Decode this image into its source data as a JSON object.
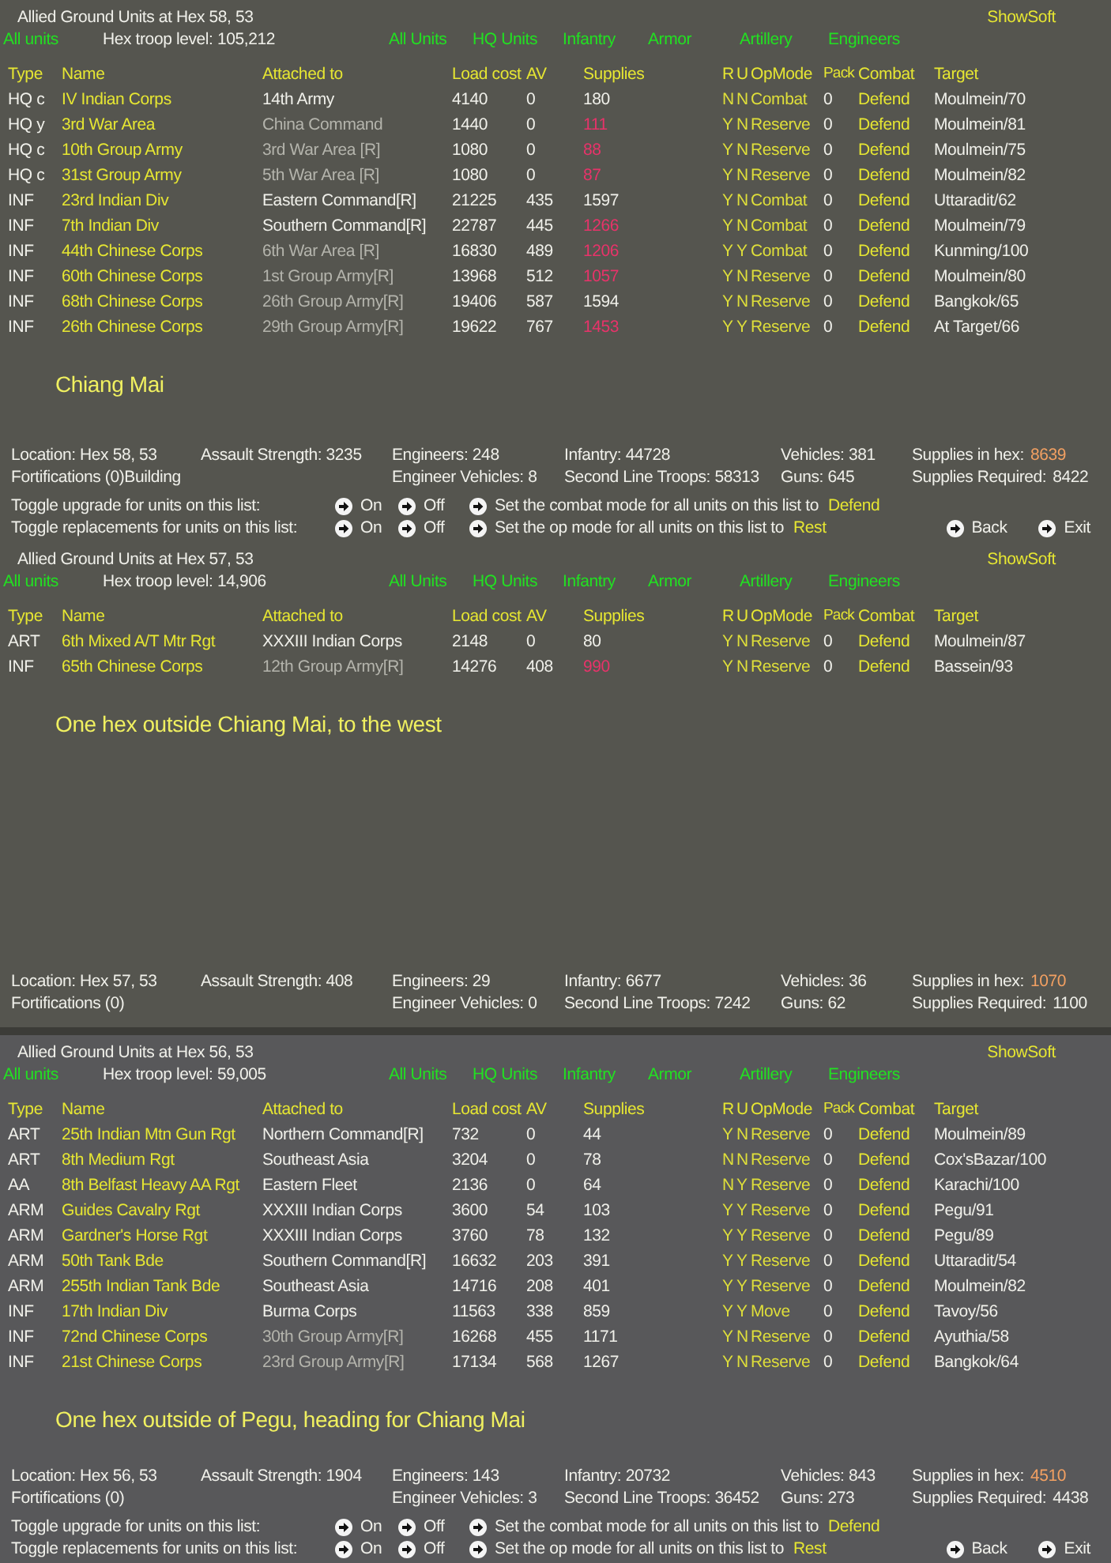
{
  "panels": [
    {
      "title": "Allied Ground Units at Hex 58, 53",
      "filter_label": "All units",
      "troop_level": "Hex troop level: 105,212",
      "filters": [
        "All Units",
        "HQ Units",
        "Infantry",
        "Armor",
        "Artillery",
        "Engineers"
      ],
      "show_soft": "ShowSoft",
      "columns": [
        "Type",
        "Name",
        "Attached to",
        "Load cost",
        "AV",
        "Supplies",
        "R",
        "U",
        "OpMode",
        "Pack",
        "Combat",
        "Target"
      ],
      "rows": [
        {
          "type": "HQ  c",
          "name": "IV Indian Corps",
          "attached": "14th Army",
          "attached_dimmed": false,
          "load": "4140",
          "av": "0",
          "supplies": "180",
          "supplies_low": false,
          "r": "N",
          "u": "N",
          "opmode": "Combat",
          "pack": "0",
          "combat": "Defend",
          "target": "Moulmein/70"
        },
        {
          "type": "HQ  y",
          "name": "3rd War Area",
          "attached": "China Command",
          "attached_dimmed": true,
          "load": "1440",
          "av": "0",
          "supplies": "111",
          "supplies_low": true,
          "r": "Y",
          "u": "N",
          "opmode": "Reserve",
          "pack": "0",
          "combat": "Defend",
          "target": "Moulmein/81"
        },
        {
          "type": "HQ  c",
          "name": "10th Group Army",
          "attached": "3rd War Area [R]",
          "attached_dimmed": true,
          "load": "1080",
          "av": "0",
          "supplies": "88",
          "supplies_low": true,
          "r": "Y",
          "u": "N",
          "opmode": "Reserve",
          "pack": "0",
          "combat": "Defend",
          "target": "Moulmein/75"
        },
        {
          "type": "HQ  c",
          "name": "31st Group Army",
          "attached": "5th War Area [R]",
          "attached_dimmed": true,
          "load": "1080",
          "av": "0",
          "supplies": "87",
          "supplies_low": true,
          "r": "Y",
          "u": "N",
          "opmode": "Reserve",
          "pack": "0",
          "combat": "Defend",
          "target": "Moulmein/82"
        },
        {
          "type": "INF",
          "name": "23rd Indian Div",
          "attached": "Eastern Command[R]",
          "attached_dimmed": false,
          "load": "21225",
          "av": "435",
          "supplies": "1597",
          "supplies_low": false,
          "r": "Y",
          "u": "N",
          "opmode": "Combat",
          "pack": "0",
          "combat": "Defend",
          "target": "Uttaradit/62"
        },
        {
          "type": "INF",
          "name": "7th Indian Div",
          "attached": "Southern Command[R]",
          "attached_dimmed": false,
          "load": "22787",
          "av": "445",
          "supplies": "1266",
          "supplies_low": true,
          "r": "Y",
          "u": "N",
          "opmode": "Combat",
          "pack": "0",
          "combat": "Defend",
          "target": "Moulmein/79"
        },
        {
          "type": "INF",
          "name": "44th Chinese Corps",
          "attached": "6th War Area [R]",
          "attached_dimmed": true,
          "load": "16830",
          "av": "489",
          "supplies": "1206",
          "supplies_low": true,
          "r": "Y",
          "u": "Y",
          "opmode": "Combat",
          "pack": "0",
          "combat": "Defend",
          "target": "Kunming/100"
        },
        {
          "type": "INF",
          "name": "60th Chinese Corps",
          "attached": "1st Group Army[R]",
          "attached_dimmed": true,
          "load": "13968",
          "av": "512",
          "supplies": "1057",
          "supplies_low": true,
          "r": "Y",
          "u": "N",
          "opmode": "Reserve",
          "pack": "0",
          "combat": "Defend",
          "target": "Moulmein/80"
        },
        {
          "type": "INF",
          "name": "68th Chinese Corps",
          "attached": "26th Group Army[R]",
          "attached_dimmed": true,
          "load": "19406",
          "av": "587",
          "supplies": "1594",
          "supplies_low": false,
          "r": "Y",
          "u": "N",
          "opmode": "Reserve",
          "pack": "0",
          "combat": "Defend",
          "target": "Bangkok/65"
        },
        {
          "type": "INF",
          "name": "26th Chinese Corps",
          "attached": "29th Group Army[R]",
          "attached_dimmed": true,
          "load": "19622",
          "av": "767",
          "supplies": "1453",
          "supplies_low": true,
          "r": "Y",
          "u": "Y",
          "opmode": "Reserve",
          "pack": "0",
          "combat": "Defend",
          "target": "At Target/66"
        }
      ],
      "note": "Chiang Mai",
      "stats": [
        [
          {
            "label": "Location: Hex 58, 53"
          },
          {
            "label": "Fortifications (0)Building"
          }
        ],
        [
          {
            "label": "Assault Strength: 3235"
          }
        ],
        [
          {
            "label": "Engineers:  248"
          },
          {
            "label": "Engineer Vehicles:  8"
          }
        ],
        [
          {
            "label": "Infantry: 44728"
          },
          {
            "label": "Second Line Troops: 58313"
          }
        ],
        [
          {
            "label": "Vehicles: 381"
          },
          {
            "label": "Guns: 645"
          }
        ],
        [
          {
            "label": "Supplies in hex:",
            "value": "8639",
            "highlight": true
          },
          {
            "label": "Supplies Required:",
            "value": "8422",
            "highlight": false
          }
        ]
      ],
      "toggles": [
        {
          "label": "Toggle upgrade for units on this list:",
          "on": "On",
          "off": "Off",
          "set_text": "Set the combat mode for all units on this list to",
          "set_value": "Defend"
        },
        {
          "label": "Toggle replacements for units on this list:",
          "on": "On",
          "off": "Off",
          "set_text": "Set the op mode for all units on this list to",
          "set_value": "Rest",
          "nav": [
            "Back",
            "Exit"
          ]
        }
      ]
    },
    {
      "title": "Allied Ground Units at Hex 57, 53",
      "filter_label": "All units",
      "troop_level": "Hex troop level: 14,906",
      "filters": [
        "All Units",
        "HQ Units",
        "Infantry",
        "Armor",
        "Artillery",
        "Engineers"
      ],
      "show_soft": "ShowSoft",
      "columns": [
        "Type",
        "Name",
        "Attached to",
        "Load cost",
        "AV",
        "Supplies",
        "R",
        "U",
        "OpMode",
        "Pack",
        "Combat",
        "Target"
      ],
      "rows": [
        {
          "type": "ART",
          "name": "6th Mixed A/T Mtr Rgt",
          "attached": "XXXIII Indian Corps",
          "attached_dimmed": false,
          "load": "2148",
          "av": "0",
          "supplies": "80",
          "supplies_low": false,
          "r": "Y",
          "u": "N",
          "opmode": "Reserve",
          "pack": "0",
          "combat": "Defend",
          "target": "Moulmein/87"
        },
        {
          "type": "INF",
          "name": "65th Chinese Corps",
          "attached": "12th Group Army[R]",
          "attached_dimmed": true,
          "load": "14276",
          "av": "408",
          "supplies": "990",
          "supplies_low": true,
          "r": "Y",
          "u": "N",
          "opmode": "Reserve",
          "pack": "0",
          "combat": "Defend",
          "target": "Bassein/93"
        }
      ],
      "note": "One hex outside Chiang Mai, to the west",
      "stats": [
        [
          {
            "label": "Location: Hex 57, 53"
          },
          {
            "label": "Fortifications (0)"
          }
        ],
        [
          {
            "label": "Assault Strength: 408"
          }
        ],
        [
          {
            "label": "Engineers:  29"
          },
          {
            "label": "Engineer Vehicles:  0"
          }
        ],
        [
          {
            "label": "Infantry: 6677"
          },
          {
            "label": "Second Line Troops: 7242"
          }
        ],
        [
          {
            "label": "Vehicles: 36"
          },
          {
            "label": "Guns: 62"
          }
        ],
        [
          {
            "label": "Supplies in hex:",
            "value": "1070",
            "highlight": true
          },
          {
            "label": "Supplies Required:",
            "value": "1100",
            "highlight": false
          }
        ]
      ]
    },
    {
      "title": "Allied Ground Units at Hex 56, 53",
      "filter_label": "All units",
      "troop_level": "Hex troop level: 59,005",
      "filters": [
        "All Units",
        "HQ Units",
        "Infantry",
        "Armor",
        "Artillery",
        "Engineers"
      ],
      "show_soft": "ShowSoft",
      "columns": [
        "Type",
        "Name",
        "Attached to",
        "Load cost",
        "AV",
        "Supplies",
        "R",
        "U",
        "OpMode",
        "Pack",
        "Combat",
        "Target"
      ],
      "rows": [
        {
          "type": "ART",
          "name": "25th Indian Mtn Gun Rgt",
          "attached": "Northern Command[R]",
          "attached_dimmed": false,
          "load": "732",
          "av": "0",
          "supplies": "44",
          "supplies_low": false,
          "r": "Y",
          "u": "N",
          "opmode": "Reserve",
          "pack": "0",
          "combat": "Defend",
          "target": "Moulmein/89"
        },
        {
          "type": "ART",
          "name": "8th Medium Rgt",
          "attached": "Southeast Asia",
          "attached_dimmed": false,
          "load": "3204",
          "av": "0",
          "supplies": "78",
          "supplies_low": false,
          "r": "N",
          "u": "N",
          "opmode": "Reserve",
          "pack": "0",
          "combat": "Defend",
          "target": "Cox'sBazar/100"
        },
        {
          "type": "AA",
          "name": "8th Belfast Heavy AA Rgt",
          "attached": "Eastern Fleet",
          "attached_dimmed": false,
          "load": "2136",
          "av": "0",
          "supplies": "64",
          "supplies_low": false,
          "r": "N",
          "u": "Y",
          "opmode": "Reserve",
          "pack": "0",
          "combat": "Defend",
          "target": "Karachi/100"
        },
        {
          "type": "ARM",
          "name": "Guides Cavalry Rgt",
          "attached": "XXXIII Indian Corps",
          "attached_dimmed": false,
          "load": "3600",
          "av": "54",
          "supplies": "103",
          "supplies_low": false,
          "r": "Y",
          "u": "Y",
          "opmode": "Reserve",
          "pack": "0",
          "combat": "Defend",
          "target": "Pegu/91"
        },
        {
          "type": "ARM",
          "name": "Gardner's Horse Rgt",
          "attached": "XXXIII Indian Corps",
          "attached_dimmed": false,
          "load": "3760",
          "av": "78",
          "supplies": "132",
          "supplies_low": false,
          "r": "Y",
          "u": "Y",
          "opmode": "Reserve",
          "pack": "0",
          "combat": "Defend",
          "target": "Pegu/89"
        },
        {
          "type": "ARM",
          "name": "50th Tank Bde",
          "attached": "Southern Command[R]",
          "attached_dimmed": false,
          "load": "16632",
          "av": "203",
          "supplies": "391",
          "supplies_low": false,
          "r": "Y",
          "u": "Y",
          "opmode": "Reserve",
          "pack": "0",
          "combat": "Defend",
          "target": "Uttaradit/54"
        },
        {
          "type": "ARM",
          "name": "255th Indian Tank Bde",
          "attached": "Southeast Asia",
          "attached_dimmed": false,
          "load": "14716",
          "av": "208",
          "supplies": "401",
          "supplies_low": false,
          "r": "Y",
          "u": "Y",
          "opmode": "Reserve",
          "pack": "0",
          "combat": "Defend",
          "target": "Moulmein/82"
        },
        {
          "type": "INF",
          "name": "17th Indian Div",
          "attached": "Burma Corps",
          "attached_dimmed": false,
          "load": "11563",
          "av": "338",
          "supplies": "859",
          "supplies_low": false,
          "r": "Y",
          "u": "Y",
          "opmode": "Move",
          "pack": "0",
          "combat": "Defend",
          "target": "Tavoy/56"
        },
        {
          "type": "INF",
          "name": "72nd Chinese Corps",
          "attached": "30th Group Army[R]",
          "attached_dimmed": true,
          "load": "16268",
          "av": "455",
          "supplies": "1171",
          "supplies_low": false,
          "r": "Y",
          "u": "N",
          "opmode": "Reserve",
          "pack": "0",
          "combat": "Defend",
          "target": "Ayuthia/58"
        },
        {
          "type": "INF",
          "name": "21st Chinese Corps",
          "attached": "23rd Group Army[R]",
          "attached_dimmed": true,
          "load": "17134",
          "av": "568",
          "supplies": "1267",
          "supplies_low": false,
          "r": "Y",
          "u": "N",
          "opmode": "Reserve",
          "pack": "0",
          "combat": "Defend",
          "target": "Bangkok/64"
        }
      ],
      "note": "One hex outside of Pegu, heading for Chiang Mai",
      "stats": [
        [
          {
            "label": "Location: Hex 56, 53"
          },
          {
            "label": "Fortifications (0)"
          }
        ],
        [
          {
            "label": "Assault Strength: 1904"
          }
        ],
        [
          {
            "label": "Engineers:  143"
          },
          {
            "label": "Engineer Vehicles:  3"
          }
        ],
        [
          {
            "label": "Infantry: 20732"
          },
          {
            "label": "Second Line Troops: 36452"
          }
        ],
        [
          {
            "label": "Vehicles: 843"
          },
          {
            "label": "Guns: 273"
          }
        ],
        [
          {
            "label": "Supplies in hex:",
            "value": "4510",
            "highlight": true
          },
          {
            "label": "Supplies Required:",
            "value": "4438",
            "highlight": false
          }
        ]
      ],
      "toggles": [
        {
          "label": "Toggle upgrade for units on this list:",
          "on": "On",
          "off": "Off",
          "set_text": "Set the combat mode for all units on this list to",
          "set_value": "Defend"
        },
        {
          "label": "Toggle replacements for units on this list:",
          "on": "On",
          "off": "Off",
          "set_text": "Set the op mode for all units on this list to",
          "set_value": "Rest",
          "nav": [
            "Back",
            "Exit"
          ]
        }
      ]
    }
  ]
}
